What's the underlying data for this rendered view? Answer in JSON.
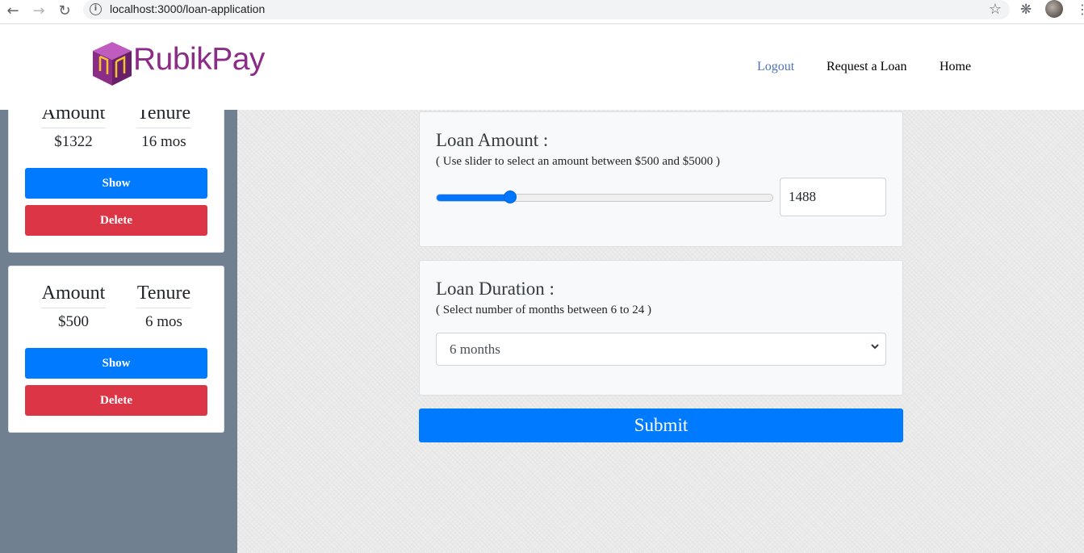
{
  "browser": {
    "url": "localhost:3000/loan-application",
    "back_icon": "arrow-left-icon",
    "forward_icon": "arrow-right-icon",
    "reload_icon": "reload-icon",
    "info_icon": "info-icon",
    "bookmark_icon": "star-icon",
    "extensions_icon": "puzzle-icon",
    "menu_icon": "more-vertical-icon"
  },
  "header": {
    "brand": "RubikPay",
    "nav": {
      "logout": "Logout",
      "request_loan": "Request a Loan",
      "home": "Home"
    },
    "colors": {
      "brand": "#8b2d86",
      "logout_link": "#4a72b8"
    }
  },
  "sidebar": {
    "cards": [
      {
        "amount_label": "Amount",
        "tenure_label": "Tenure",
        "amount": "$1322",
        "tenure": "16 mos",
        "show_label": "Show",
        "delete_label": "Delete"
      },
      {
        "amount_label": "Amount",
        "tenure_label": "Tenure",
        "amount": "$500",
        "tenure": "6 mos",
        "show_label": "Show",
        "delete_label": "Delete"
      }
    ]
  },
  "form": {
    "amount": {
      "title": "Loan Amount :",
      "hint": "( Use slider to select an amount between $500 and $5000 )",
      "min": 500,
      "max": 5000,
      "value": "1488",
      "slider_value": 1488
    },
    "duration": {
      "title": "Loan Duration :",
      "hint": "( Select number of months between 6 to 24 )",
      "selected": "6 months"
    },
    "submit_label": "Submit"
  },
  "colors": {
    "primary": "#007bff",
    "danger": "#dc3545",
    "sidebar_bg": "#708090"
  }
}
